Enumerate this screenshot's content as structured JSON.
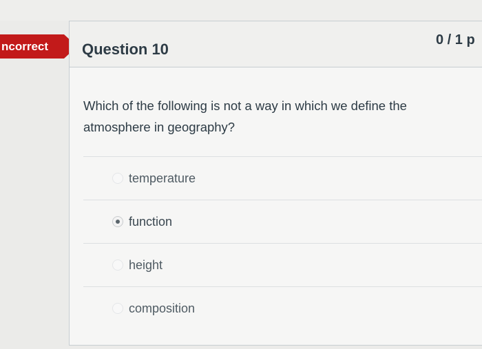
{
  "status": {
    "label": "ncorrect",
    "color": "#c21a1a"
  },
  "question": {
    "title": "Question 10",
    "points": "0 / 1 p",
    "text": "Which of the following is not a way in which we define the atmosphere in geography?",
    "answers": [
      {
        "label": "temperature",
        "selected": false
      },
      {
        "label": "function",
        "selected": true
      },
      {
        "label": "height",
        "selected": false
      },
      {
        "label": "composition",
        "selected": false
      }
    ]
  }
}
